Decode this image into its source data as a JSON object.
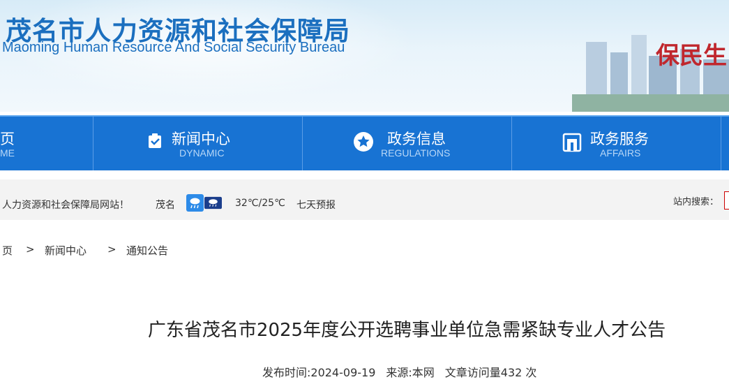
{
  "banner": {
    "title_cn": "茂名市人力资源和社会保障局",
    "title_en": "Maoming Human Resource And Social Security Bureau",
    "slogan": "保民生"
  },
  "nav": {
    "items": [
      {
        "cn": "页",
        "en": "ME"
      },
      {
        "cn": "新闻中心",
        "en": "DYNAMIC",
        "icon": "news-icon"
      },
      {
        "cn": "政务信息",
        "en": "REGULATIONS",
        "icon": "star-icon"
      },
      {
        "cn": "政务服务",
        "en": "AFFAIRS",
        "icon": "service-icon"
      }
    ]
  },
  "infobar": {
    "welcome": "人力资源和社会保障局网站！",
    "city": "茂名",
    "temperature": "32℃/25℃",
    "forecast": "七天预报",
    "search_label": "站内搜索：",
    "weather_icons": [
      "rain-icon",
      "thunderstorm-icon"
    ]
  },
  "breadcrumb": {
    "home": "页",
    "sep": ">",
    "level1": "新闻中心",
    "level2": "通知公告"
  },
  "article": {
    "title": "广东省茂名市2025年度公开选聘事业单位急需紧缺专业人才公告",
    "publish_time": "发布时间:2024-09-19",
    "source": "来源:本网",
    "visits": "文章访问量432 次"
  },
  "colors": {
    "nav_bg": "#1873d3",
    "title_blue": "#1b6fbf",
    "slogan_red": "#c0272d"
  }
}
